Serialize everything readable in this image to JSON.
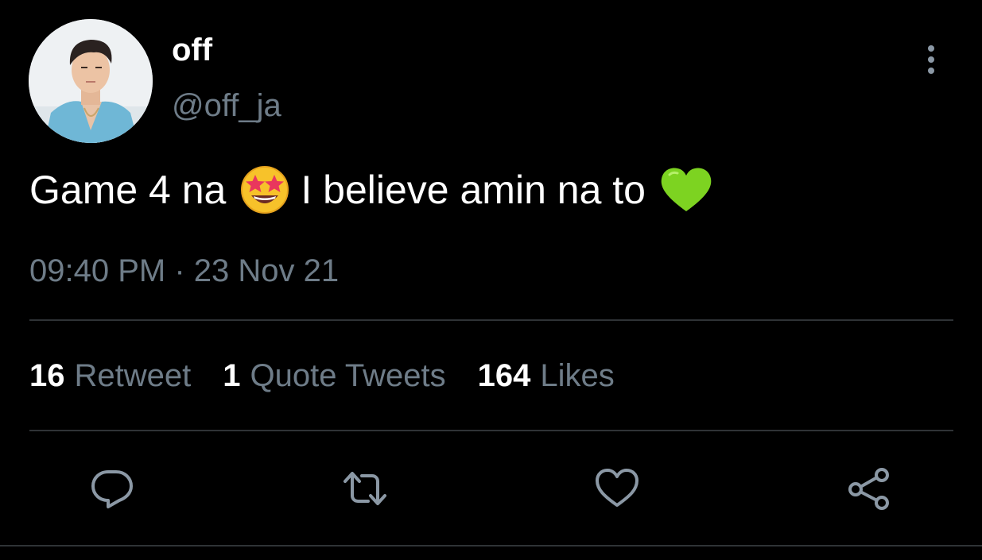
{
  "author": {
    "display_name": "off",
    "handle": "@off_ja"
  },
  "tweet": {
    "text_part1": "Game 4 na",
    "emoji_1": "star-struck-emoji",
    "text_part2": "I believe amin na to",
    "emoji_2": "green-heart-emoji",
    "timestamp": "09:40 PM · 23 Nov 21"
  },
  "stats": {
    "retweets_count": "16",
    "retweets_label": "Retweet",
    "quotes_count": "1",
    "quotes_label": "Quote Tweets",
    "likes_count": "164",
    "likes_label": "Likes"
  },
  "actions": {
    "reply_icon": "reply-icon",
    "retweet_icon": "retweet-icon",
    "like_icon": "heart-icon",
    "share_icon": "share-icon",
    "more_icon": "more-vertical-icon"
  },
  "colors": {
    "background": "#000000",
    "text_primary": "#ffffff",
    "text_secondary": "#6e7c88",
    "divider": "#2f3336",
    "icon": "#8b98a5"
  }
}
